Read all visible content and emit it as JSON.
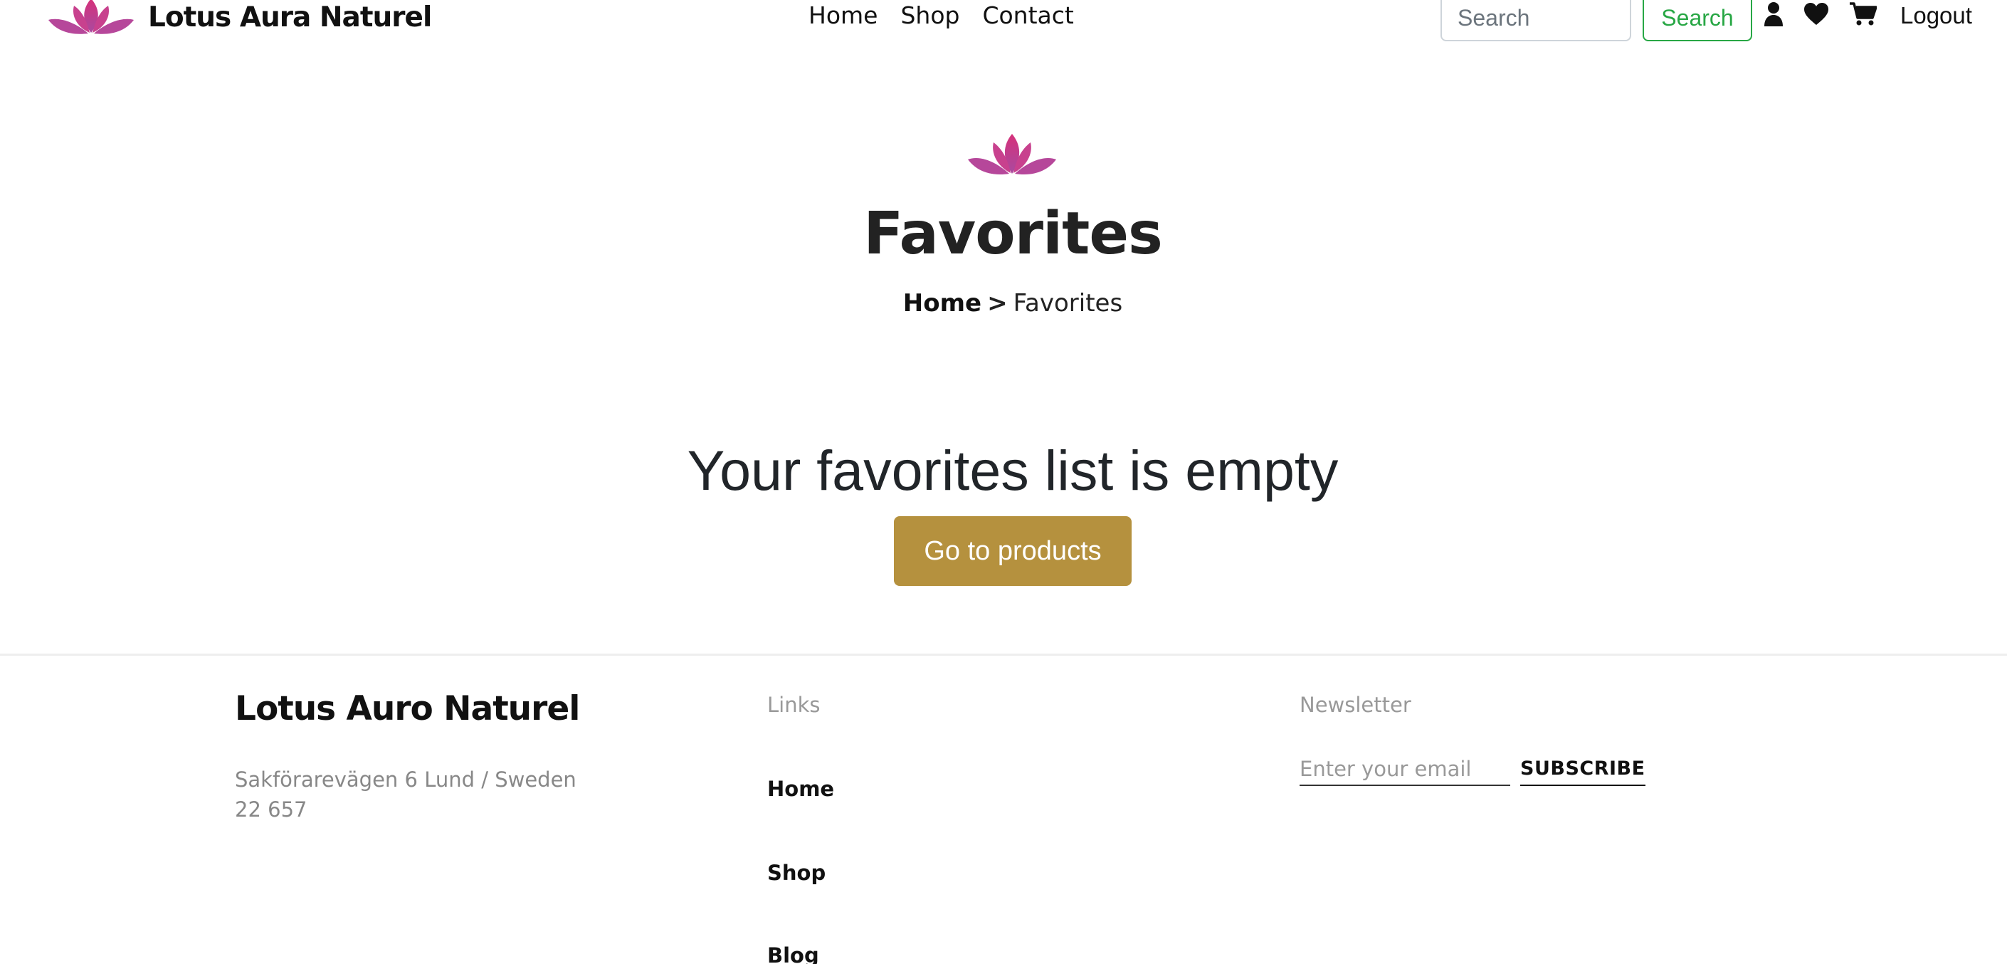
{
  "header": {
    "brand_name": "Lotus Aura Naturel",
    "nav": [
      {
        "label": "Home"
      },
      {
        "label": "Shop"
      },
      {
        "label": "Contact"
      }
    ],
    "search_placeholder": "Search",
    "search_button": "Search",
    "icons": [
      "user-icon",
      "heart-icon",
      "cart-icon"
    ],
    "logout_label": "Logout"
  },
  "page": {
    "title": "Favorites",
    "breadcrumb": {
      "home": "Home",
      "separator": ">",
      "current": "Favorites"
    },
    "empty_message": "Your favorites list is empty",
    "cta_label": "Go to products"
  },
  "footer": {
    "brand_name": "Lotus Auro Naturel",
    "address_line1": "Sakförarevägen 6 Lund / Sweden",
    "address_line2": "22 657",
    "links_heading": "Links",
    "links": [
      {
        "label": "Home"
      },
      {
        "label": "Shop"
      },
      {
        "label": "Blog"
      }
    ],
    "newsletter_heading": "Newsletter",
    "newsletter_placeholder": "Enter your email",
    "subscribe_label": "SUBSCRIBE"
  },
  "colors": {
    "accent_gold": "#b5913e",
    "search_green": "#28a745",
    "lotus_pink": "#c2408f"
  }
}
